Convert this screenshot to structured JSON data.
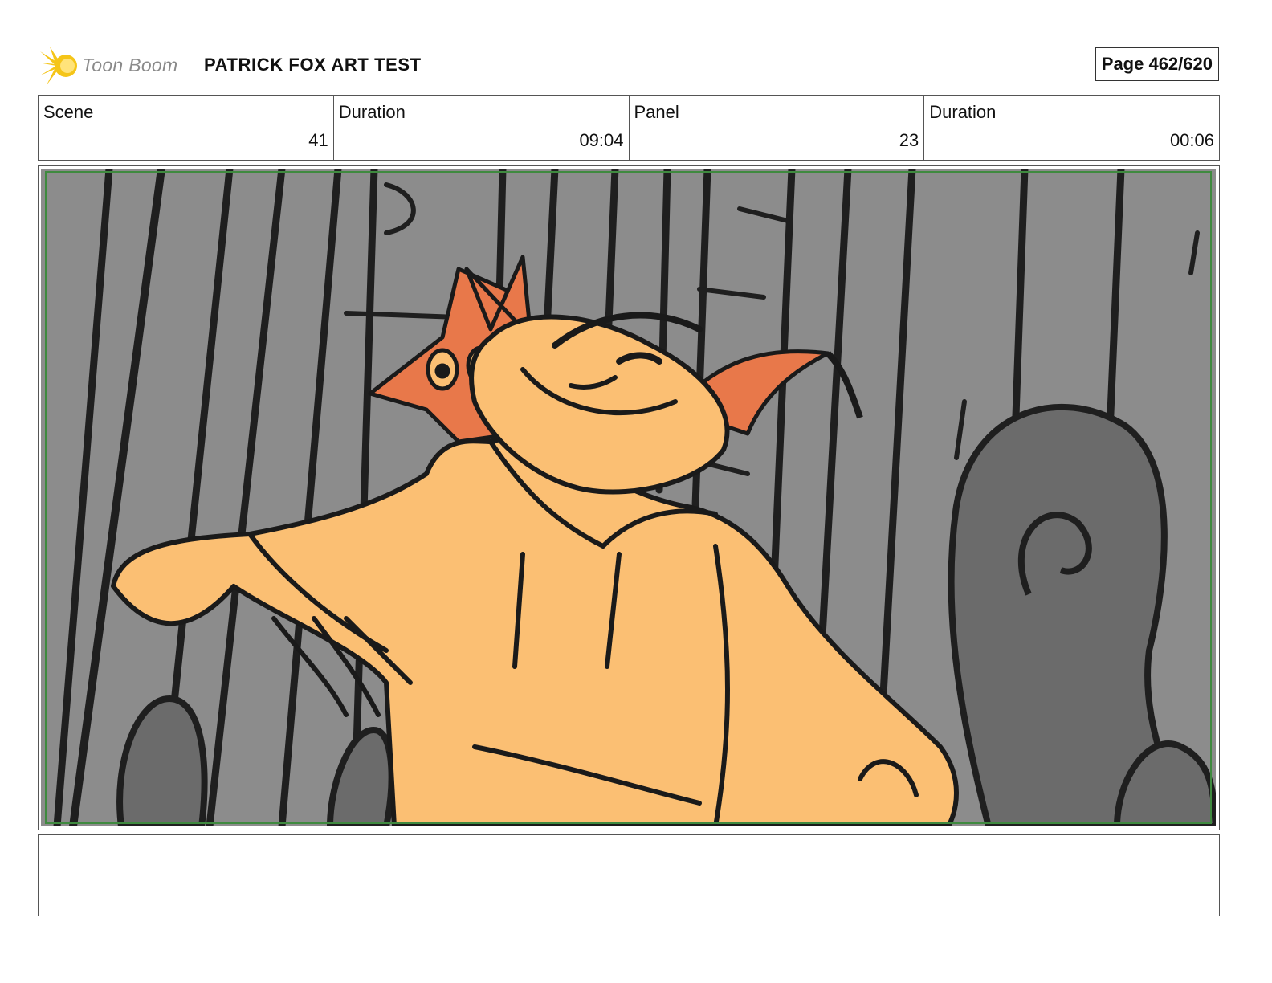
{
  "header": {
    "logo": {
      "name": "toon-boom-logo",
      "text": "Toon Boom"
    },
    "project_title": "PATRICK FOX ART TEST",
    "page_label": "Page 462/620"
  },
  "info": {
    "scene_label": "Scene",
    "scene_value": "41",
    "scene_duration_label": "Duration",
    "scene_duration_value": "09:04",
    "panel_label": "Panel",
    "panel_value": "23",
    "panel_duration_label": "Duration",
    "panel_duration_value": "00:06"
  },
  "panel": {
    "image": "storyboard-sketch-fox-characters-in-forest",
    "colors": {
      "background": "#8c8c8c",
      "tree_dark": "#6b6b6b",
      "hoodie": "#fbbf73",
      "fox_orange": "#e8784a",
      "line": "#1a1a1a",
      "safe_frame": "#3f8a3f"
    }
  },
  "notes": {
    "text": ""
  }
}
